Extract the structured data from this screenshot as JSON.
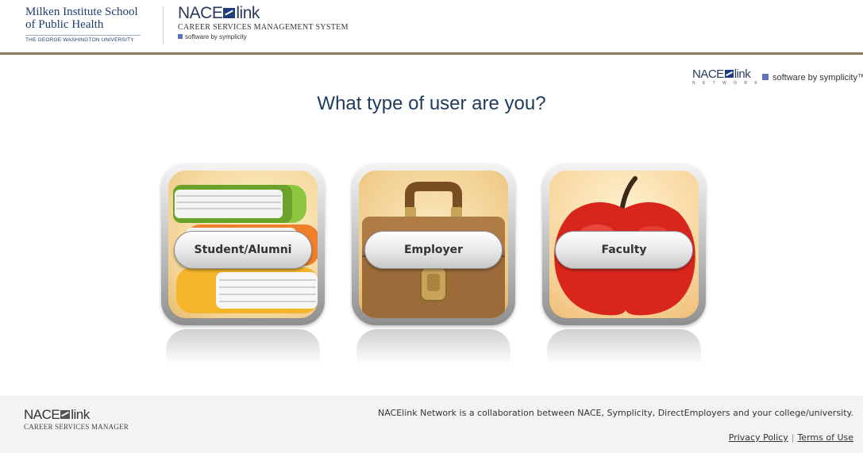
{
  "header": {
    "school_line1": "Milken Institute School",
    "school_line2": "of Public Health",
    "university": "THE GEORGE WASHINGTON UNIVERSITY",
    "product_logo_left": "NACE",
    "product_logo_right": "link",
    "product_subtitle": "CAREER SERVICES MANAGEMENT SYSTEM",
    "product_tagline": "software by symplicity"
  },
  "network_logo": {
    "logo_left": "NACE",
    "logo_right": "link",
    "logo_word": "N E T W O R K",
    "tagline": "software by symplicity™"
  },
  "title": "What type of user are you?",
  "tiles": [
    {
      "label": "Student/Alumni",
      "icon": "books-icon"
    },
    {
      "label": "Employer",
      "icon": "briefcase-icon"
    },
    {
      "label": "Faculty",
      "icon": "apple-icon"
    }
  ],
  "footer": {
    "logo_left": "NACE",
    "logo_right": "link",
    "logo_subtitle": "CAREER SERVICES MANAGER",
    "collaboration_text": "NACElink Network is a collaboration between NACE, Symplicity, DirectEmployers and your college/university.",
    "privacy_label": "Privacy Policy",
    "separator": "|",
    "terms_label": "Terms of Use"
  },
  "colors": {
    "title": "#1e3b5e",
    "header_rule": "#8f7a5c",
    "brand_blue": "#1f3d6e",
    "footer_bg": "#f3f3f3"
  }
}
